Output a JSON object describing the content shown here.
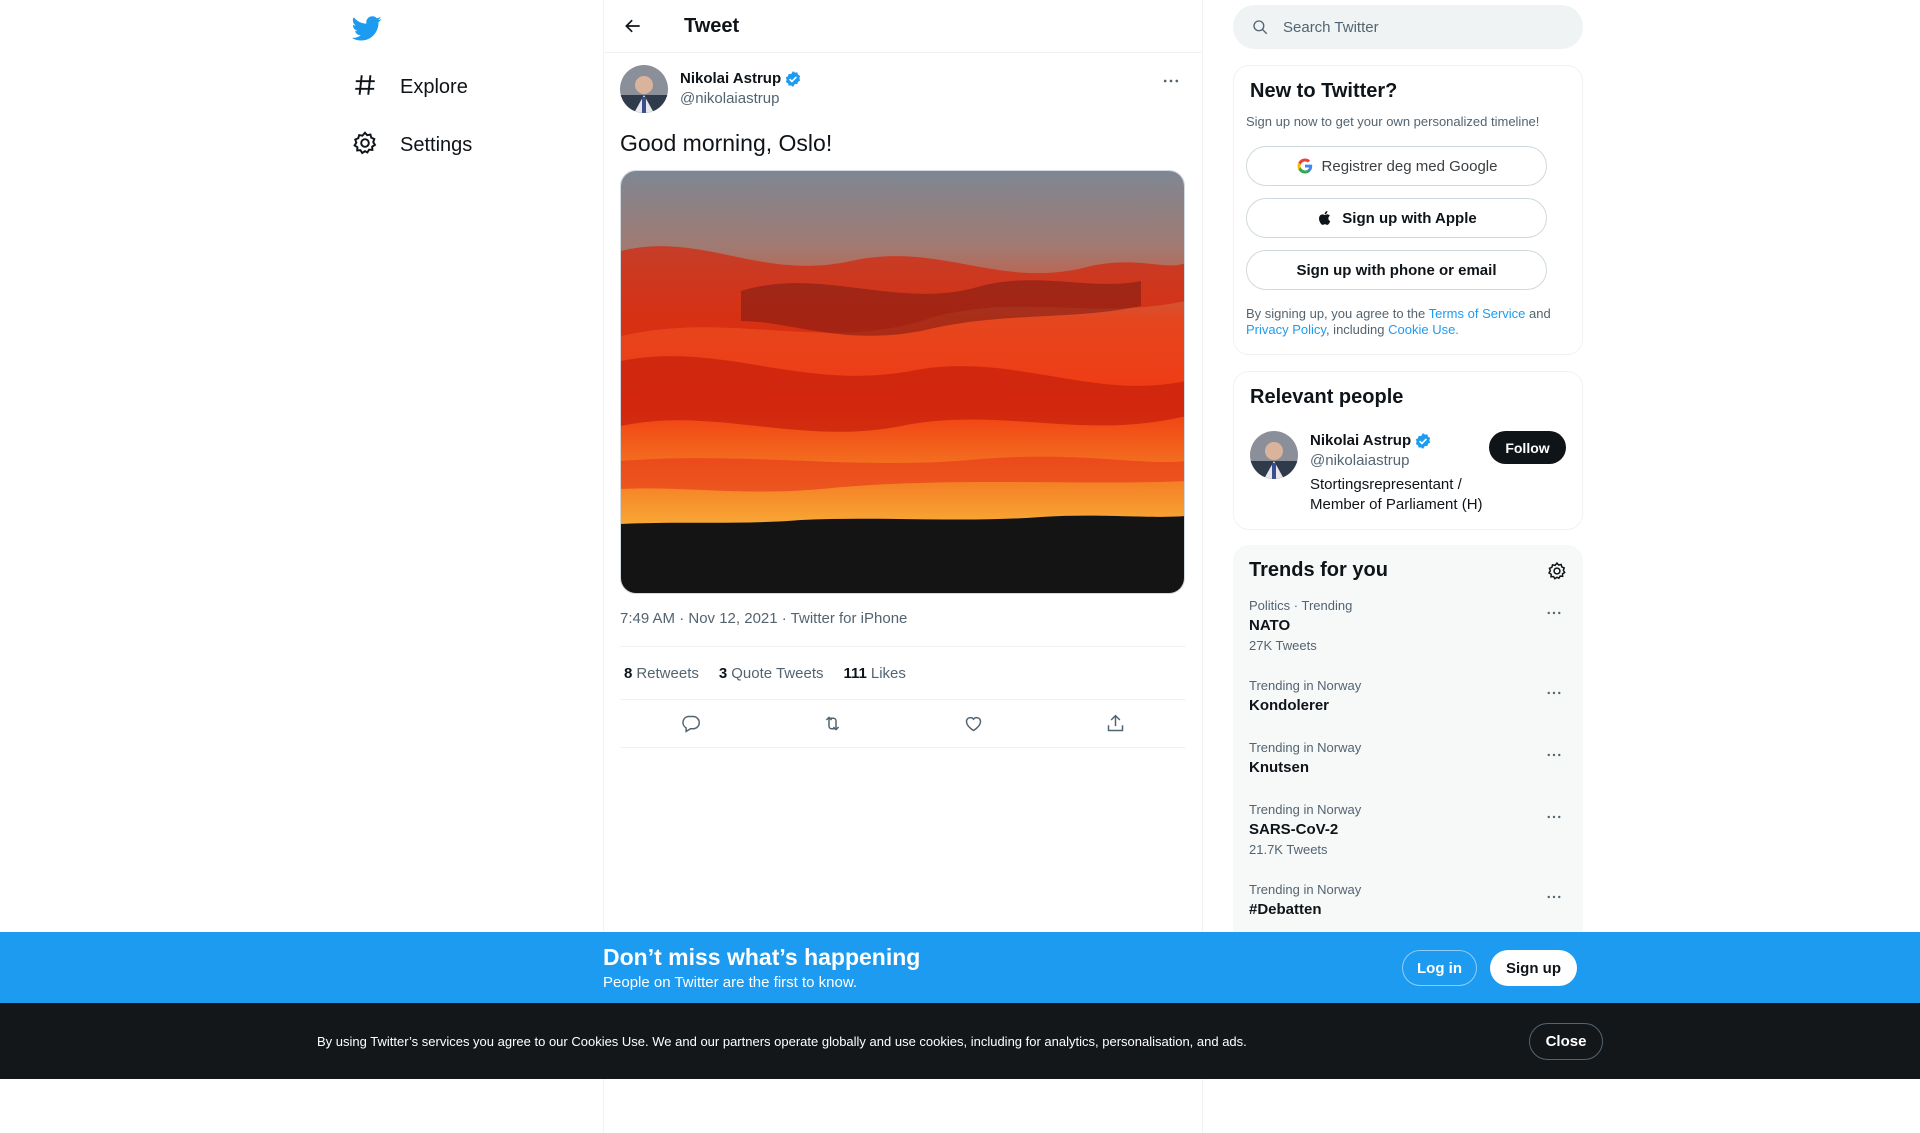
{
  "nav": {
    "explore_label": "Explore",
    "settings_label": "Settings"
  },
  "header": {
    "title": "Tweet"
  },
  "tweet": {
    "author_name": "Nikolai Astrup",
    "author_handle": "@nikolaiastrup",
    "text": "Good morning, Oslo!",
    "time": "7:49 AM · Nov 12, 2021",
    "separator": " · ",
    "source": "Twitter for iPhone",
    "stats": {
      "retweets_count": "8",
      "retweets_label": "Retweets",
      "quotes_count": "3",
      "quotes_label": "Quote Tweets",
      "likes_count": "111",
      "likes_label": "Likes"
    }
  },
  "search": {
    "placeholder": "Search Twitter"
  },
  "new_to_twitter": {
    "title": "New to Twitter?",
    "subtitle": "Sign up now to get your own personalized timeline!",
    "google_label": "Registrer deg med Google",
    "apple_label": "Sign up with Apple",
    "phone_label": "Sign up with phone or email",
    "legal_prefix": "By signing up, you agree to the ",
    "terms_link": "Terms of Service",
    "legal_and": " and ",
    "privacy_link": "Privacy Policy",
    "legal_including": ", including ",
    "cookie_link": "Cookie Use."
  },
  "relevant_people": {
    "title": "Relevant people",
    "name": "Nikolai Astrup",
    "handle": "@nikolaiastrup",
    "bio": "Stortingsrepresentant / Member of Parliament (H)",
    "follow_label": "Follow"
  },
  "trends": {
    "title": "Trends for you",
    "items": [
      {
        "context": "Politics · Trending",
        "name": "NATO",
        "count": "27K Tweets"
      },
      {
        "context": "Trending in Norway",
        "name": "Kondolerer",
        "count": ""
      },
      {
        "context": "Trending in Norway",
        "name": "Knutsen",
        "count": ""
      },
      {
        "context": "Trending in Norway",
        "name": "SARS-CoV-2",
        "count": "21.7K Tweets"
      },
      {
        "context": "Trending in Norway",
        "name": "#Debatten",
        "count": ""
      }
    ]
  },
  "signup_bar": {
    "title": "Don’t miss what’s happening",
    "subtitle": "People on Twitter are the first to know.",
    "login_label": "Log in",
    "signup_label": "Sign up"
  },
  "cookie_bar": {
    "text": "By using Twitter’s services you agree to our Cookies Use. We and our partners operate globally and use cookies, including for analytics, personalisation, and ads.",
    "close_label": "Close"
  },
  "colors": {
    "brand_blue": "#1d9bf0",
    "dark": "#0f1419",
    "muted": "#536471",
    "cookie_bg": "#14171a"
  },
  "icons": [
    "twitter-logo-icon",
    "hashtag-icon",
    "gear-icon",
    "back-arrow-icon",
    "verified-icon",
    "more-icon",
    "search-icon",
    "google-icon",
    "apple-icon",
    "reply-icon",
    "retweet-icon",
    "like-icon",
    "share-icon"
  ]
}
